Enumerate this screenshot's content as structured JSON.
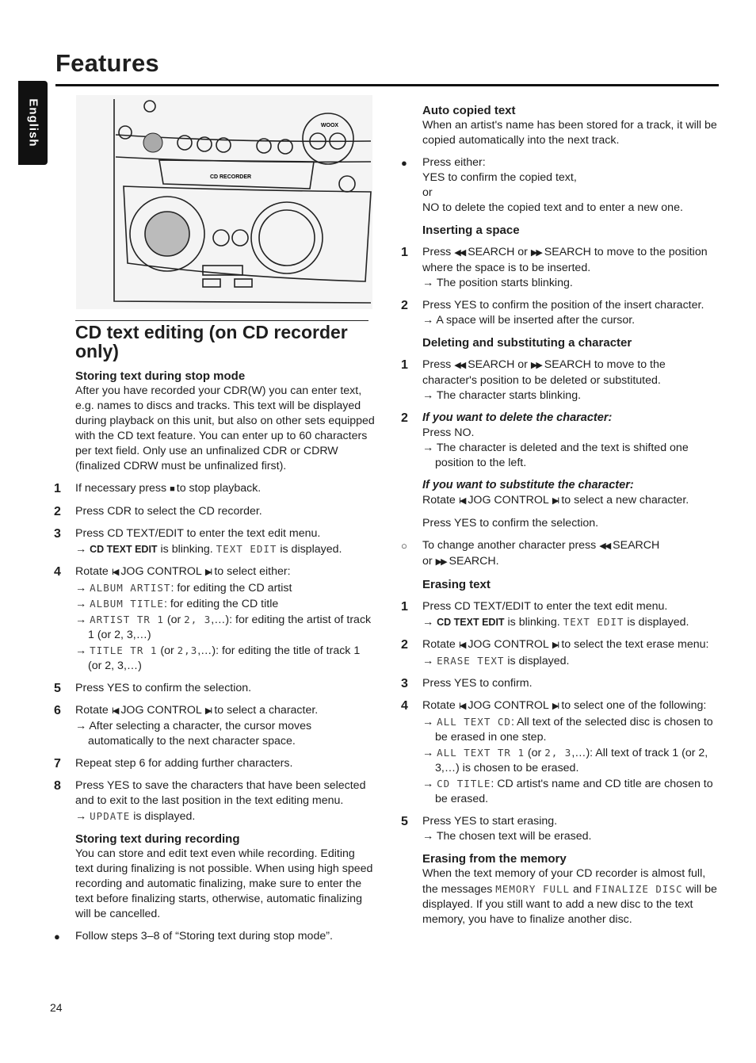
{
  "header": {
    "title": "Features",
    "language_tab": "English"
  },
  "illustration": {
    "labels": [
      "CD RECORDER",
      "WOOX"
    ]
  },
  "page_number": "24",
  "left": {
    "blocks": [
      {
        "type": "h2",
        "text": "CD text editing (on CD recorder only)"
      },
      {
        "type": "h3",
        "text": "Storing text during stop mode"
      },
      {
        "type": "para",
        "lines": [
          [
            "After you have recorded your CDR(W) you can enter text, e.g. names to discs and tracks. This text will be displayed during playback on this unit, but also on other sets equipped with the CD text feature. You can enter up to 60 characters per text field. Only use an unfinalized CDR or CDRW (finalized CDRW must be unfinalized first)."
          ]
        ]
      },
      {
        "type": "step",
        "num": "1",
        "lines": [
          [
            "If necessary press",
            {
              "icon": "stop"
            },
            "to stop playback."
          ]
        ]
      },
      {
        "type": "step",
        "num": "2",
        "lines": [
          [
            "Press CDR to select the CD recorder."
          ]
        ]
      },
      {
        "type": "step",
        "num": "3",
        "lines": [
          [
            "Press CD TEXT/EDIT to enter the text edit menu."
          ],
          [
            "→ ",
            {
              "b": "CD TEXT EDIT"
            },
            " is blinking. ",
            {
              "lcd": "TEXT EDIT"
            },
            " is displayed."
          ]
        ]
      },
      {
        "type": "step",
        "num": "4",
        "lines": [
          [
            "Rotate",
            {
              "icon": "prev"
            },
            "JOG CONTROL",
            {
              "icon": "next"
            },
            "to select either:"
          ],
          [
            "→ ",
            {
              "lcd": "ALBUM ARTIST"
            },
            ": for editing the CD artist"
          ],
          [
            "→ ",
            {
              "lcd": "ALBUM TITLE"
            },
            ": for editing the CD title"
          ],
          [
            "→ ",
            {
              "lcd": "ARTIST TR 1"
            },
            " (or ",
            {
              "lcd": "2, 3"
            },
            ",…): for editing the artist of track 1 (or 2, 3,…)"
          ],
          [
            "→ ",
            {
              "lcd": "TITLE TR 1"
            },
            " (or ",
            {
              "lcd": "2,3"
            },
            ",…): for editing the title of track 1 (or 2, 3,…)"
          ]
        ]
      },
      {
        "type": "step",
        "num": "5",
        "lines": [
          [
            "Press YES to confirm the selection."
          ]
        ]
      },
      {
        "type": "step",
        "num": "6",
        "lines": [
          [
            "Rotate",
            {
              "icon": "prev"
            },
            "JOG CONTROL",
            {
              "icon": "next"
            },
            "to select a character."
          ],
          [
            "→ After selecting a character, the cursor moves automatically to the next character space."
          ]
        ]
      },
      {
        "type": "step",
        "num": "7",
        "lines": [
          [
            "Repeat step 6 for adding further characters."
          ]
        ]
      },
      {
        "type": "step",
        "num": "8",
        "lines": [
          [
            "Press YES to save the characters that have been selected and to exit to the last position in the text editing menu."
          ],
          [
            "→ ",
            {
              "lcd": "UPDATE"
            },
            " is displayed."
          ]
        ]
      },
      {
        "type": "h3",
        "text": "Storing text during recording"
      },
      {
        "type": "para",
        "lines": [
          [
            "You can store and edit text even while recording. Editing text during finalizing is not possible. When using high speed recording and automatic finalizing, make sure to enter the text before finalizing starts, otherwise, automatic finalizing will be cancelled."
          ]
        ]
      },
      {
        "type": "bullet",
        "sym": "●",
        "lines": [
          [
            "Follow steps 3–8 of “Storing text during stop mode”."
          ]
        ]
      }
    ]
  },
  "right": {
    "blocks": [
      {
        "type": "h3",
        "text": "Auto copied text"
      },
      {
        "type": "para",
        "lines": [
          [
            "When an artist's name has been stored for a track, it will be copied automatically into the next track."
          ]
        ]
      },
      {
        "type": "bullet",
        "sym": "●",
        "lines": [
          [
            "Press either:"
          ],
          [
            "YES to confirm the copied text,"
          ],
          [
            "or"
          ],
          [
            "NO to delete the copied text and to enter a new one."
          ]
        ]
      },
      {
        "type": "h3",
        "text": "Inserting a space"
      },
      {
        "type": "step",
        "num": "1",
        "lines": [
          [
            "Press",
            {
              "icon": "rewind"
            },
            "SEARCH or",
            {
              "icon": "fast-forward"
            },
            "SEARCH to move to the position where the space is to be inserted."
          ],
          [
            "→ The position starts blinking."
          ]
        ]
      },
      {
        "type": "step",
        "num": "2",
        "lines": [
          [
            "Press YES to confirm the position of the insert character."
          ],
          [
            "→ A space will be inserted after the cursor."
          ]
        ]
      },
      {
        "type": "h3",
        "text": "Deleting and substituting a character"
      },
      {
        "type": "step",
        "num": "1",
        "lines": [
          [
            "Press",
            {
              "icon": "rewind"
            },
            "SEARCH or",
            {
              "icon": "fast-forward"
            },
            "SEARCH to move to the character's position to be deleted or substituted."
          ],
          [
            "→ The character starts blinking."
          ]
        ]
      },
      {
        "type": "step",
        "num": "2",
        "italic_heading": "If you want to delete the character:",
        "lines": [
          [
            "Press NO."
          ],
          [
            "→ The character is deleted and the text is shifted one position to the left."
          ]
        ]
      },
      {
        "type": "h3i",
        "text": "If you want to substitute the character:"
      },
      {
        "type": "para",
        "lines": [
          [
            "Rotate",
            {
              "icon": "prev"
            },
            "JOG CONTROL",
            {
              "icon": "next"
            },
            "to select a new character."
          ]
        ]
      },
      {
        "type": "gap"
      },
      {
        "type": "para",
        "lines": [
          [
            "Press YES to confirm the selection."
          ]
        ]
      },
      {
        "type": "bullet",
        "sym": "○",
        "lines": [
          [
            "To change another character press",
            {
              "icon": "rewind"
            },
            "SEARCH or",
            {
              "icon": "fast-forward"
            },
            "SEARCH."
          ]
        ]
      },
      {
        "type": "h3",
        "text": "Erasing text"
      },
      {
        "type": "step",
        "num": "1",
        "lines": [
          [
            "Press CD TEXT/EDIT to enter the text edit menu."
          ],
          [
            "→ ",
            {
              "b": "CD TEXT EDIT"
            },
            " is blinking. ",
            {
              "lcd": "TEXT EDIT"
            },
            " is displayed."
          ]
        ]
      },
      {
        "type": "step",
        "num": "2",
        "lines": [
          [
            "Rotate",
            {
              "icon": "prev"
            },
            "JOG CONTROL",
            {
              "icon": "next"
            },
            "to select the text erase menu:"
          ],
          [
            "→ ",
            {
              "lcd": "ERASE TEXT"
            },
            " is displayed."
          ]
        ]
      },
      {
        "type": "step",
        "num": "3",
        "lines": [
          [
            "Press YES to confirm."
          ]
        ]
      },
      {
        "type": "step",
        "num": "4",
        "lines": [
          [
            "Rotate",
            {
              "icon": "prev"
            },
            "JOG CONTROL",
            {
              "icon": "next"
            },
            "to select one of the following:"
          ],
          [
            "→ ",
            {
              "lcd": "ALL TEXT CD"
            },
            ": All text of the selected disc is chosen to be erased in one step."
          ],
          [
            "→ ",
            {
              "lcd": "ALL TEXT TR 1"
            },
            " (or ",
            {
              "lcd": "2, 3"
            },
            ",…): All text of track 1 (or 2, 3,…) is chosen to be erased."
          ],
          [
            "→ ",
            {
              "lcd": "CD TITLE"
            },
            ": CD artist's name and CD title are chosen to be erased."
          ]
        ]
      },
      {
        "type": "step",
        "num": "5",
        "lines": [
          [
            "Press YES to start erasing."
          ],
          [
            "→ The chosen text will be erased."
          ]
        ]
      },
      {
        "type": "h3",
        "text": "Erasing from the memory"
      },
      {
        "type": "para",
        "lines": [
          [
            "When the text memory of your CD recorder is almost full, the messages ",
            {
              "lcd": "MEMORY FULL"
            },
            " and ",
            {
              "lcd": "FINALIZE DISC"
            },
            " will be displayed. If you still want to add a new disc to the text memory, you have to finalize another disc."
          ]
        ]
      }
    ]
  }
}
